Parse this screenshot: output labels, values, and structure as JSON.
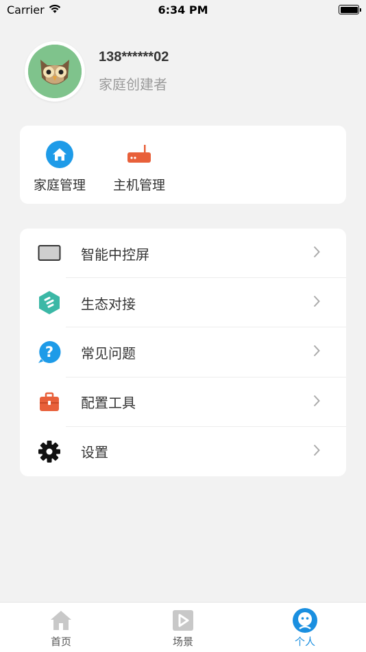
{
  "status_bar": {
    "carrier": "Carrier",
    "time": "6:34 PM"
  },
  "profile": {
    "phone": "138******02",
    "role": "家庭创建者"
  },
  "quick_actions": [
    {
      "label": "家庭管理",
      "icon": "home-icon"
    },
    {
      "label": "主机管理",
      "icon": "router-icon"
    }
  ],
  "menu": [
    {
      "label": "智能中控屏",
      "icon": "screen-icon"
    },
    {
      "label": "生态对接",
      "icon": "ecosystem-icon"
    },
    {
      "label": "常见问题",
      "icon": "help-icon"
    },
    {
      "label": "配置工具",
      "icon": "toolbox-icon"
    },
    {
      "label": "设置",
      "icon": "gear-icon"
    }
  ],
  "tabs": [
    {
      "label": "首页",
      "icon": "home-tab-icon",
      "active": false
    },
    {
      "label": "场景",
      "icon": "scene-tab-icon",
      "active": false
    },
    {
      "label": "个人",
      "icon": "profile-tab-icon",
      "active": true
    }
  ],
  "colors": {
    "accent": "#1a8fe0",
    "home_icon": "#1e9be8",
    "router_icon": "#e8603a",
    "ecosystem_icon": "#3bb8a6",
    "toolbox_icon": "#e8603a",
    "avatar_bg": "#7fc38c"
  }
}
